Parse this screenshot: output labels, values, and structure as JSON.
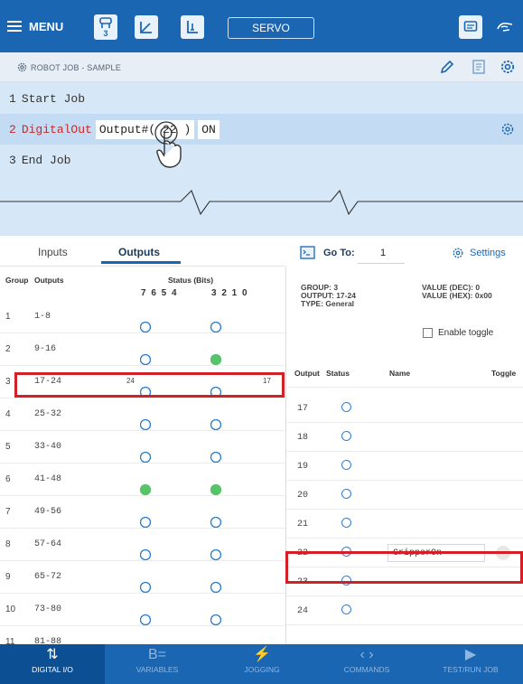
{
  "topbar": {
    "menu_label": "MENU",
    "group_badge": "3",
    "servo_label": "SERVO",
    "bg": "#1a66b3"
  },
  "job_header": {
    "label": "ROBOT JOB - SAMPLE"
  },
  "job_lines": [
    {
      "num": "1",
      "text": "Start Job"
    },
    {
      "num": "2",
      "keyword": "DigitalOut",
      "param": "Output#( 22 )",
      "value": "ON"
    },
    {
      "num": "3",
      "text": "End Job"
    }
  ],
  "tabs": {
    "inputs": "Inputs",
    "outputs": "Outputs"
  },
  "goto": {
    "label": "Go To:",
    "value": "1",
    "settings": "Settings"
  },
  "left_table": {
    "headers": {
      "group": "Group",
      "outputs": "Outputs",
      "status": "Status (Bits)",
      "bits_hi": "7 6 5 4",
      "bits_lo": "3 2 1 0"
    },
    "range_label_left": "24",
    "range_label_right": "17",
    "rows": [
      {
        "group": "1",
        "outputs": "1-8",
        "bits": [
          0,
          0,
          0,
          0,
          0,
          0,
          0,
          0
        ]
      },
      {
        "group": "2",
        "outputs": "9-16",
        "bits": [
          0,
          0,
          0,
          0,
          0,
          0,
          1,
          1
        ]
      },
      {
        "group": "3",
        "outputs": "17-24",
        "bits": [
          0,
          0,
          0,
          0,
          0,
          0,
          0,
          0
        ]
      },
      {
        "group": "4",
        "outputs": "25-32",
        "bits": [
          0,
          0,
          0,
          0,
          0,
          0,
          0,
          0
        ]
      },
      {
        "group": "5",
        "outputs": "33-40",
        "bits": [
          0,
          0,
          0,
          0,
          0,
          0,
          0,
          0
        ]
      },
      {
        "group": "6",
        "outputs": "41-48",
        "bits": [
          1,
          1,
          1,
          1,
          1,
          1,
          1,
          1
        ]
      },
      {
        "group": "7",
        "outputs": "49-56",
        "bits": [
          0,
          0,
          0,
          0,
          0,
          0,
          0,
          0
        ]
      },
      {
        "group": "8",
        "outputs": "57-64",
        "bits": [
          0,
          0,
          0,
          0,
          0,
          0,
          0,
          0
        ]
      },
      {
        "group": "9",
        "outputs": "65-72",
        "bits": [
          0,
          0,
          0,
          0,
          0,
          0,
          0,
          0
        ]
      },
      {
        "group": "10",
        "outputs": "73-80",
        "bits": [
          0,
          0,
          0,
          0,
          0,
          0,
          0,
          0
        ]
      },
      {
        "group": "11",
        "outputs": "81-88",
        "bits": [
          0,
          0,
          0,
          0,
          0,
          0,
          0,
          0
        ]
      }
    ]
  },
  "group_info": {
    "group": "GROUP: 3",
    "output": "OUTPUT: 17-24",
    "type": "TYPE: General",
    "value_dec": "VALUE (DEC): 0",
    "value_hex": "VALUE (HEX): 0x00",
    "enable_toggle": "Enable toggle"
  },
  "right_table": {
    "headers": {
      "output": "Output",
      "status": "Status",
      "name": "Name",
      "toggle": "Toggle"
    },
    "rows": [
      {
        "output": "17",
        "name": ""
      },
      {
        "output": "18",
        "name": ""
      },
      {
        "output": "19",
        "name": ""
      },
      {
        "output": "20",
        "name": ""
      },
      {
        "output": "21",
        "name": ""
      },
      {
        "output": "22",
        "name": "GripperOn"
      },
      {
        "output": "23",
        "name": ""
      },
      {
        "output": "24",
        "name": ""
      }
    ]
  },
  "bottom_nav": [
    {
      "icon": "digital-io-icon",
      "label": "DIGITAL I/O",
      "active": true
    },
    {
      "icon": "variables-icon",
      "label": "VARIABLES"
    },
    {
      "icon": "jogging-icon",
      "label": "JOGGING"
    },
    {
      "icon": "commands-icon",
      "label": "COMMANDS"
    },
    {
      "icon": "test-run-icon",
      "label": "TEST/RUN JOB"
    }
  ],
  "colors": {
    "accent": "#1a66b3",
    "on_bit": "#57c468",
    "highlight": "#d32027",
    "keyword": "#c62828"
  }
}
